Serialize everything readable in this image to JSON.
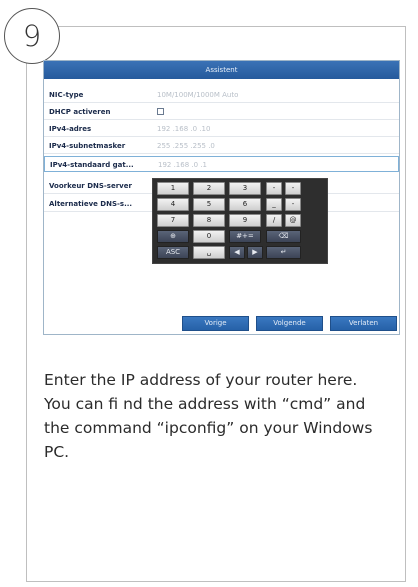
{
  "step_number": "9",
  "dialog": {
    "title": "Assistent",
    "fields": [
      {
        "label": "NIC-type",
        "value": "10M/100M/1000M Auto"
      },
      {
        "label": "DHCP activeren",
        "value": ""
      },
      {
        "label": "IPv4-adres",
        "value": "192 .168 .0    .10"
      },
      {
        "label": "IPv4-subnetmasker",
        "value": "255 .255 .255 .0"
      },
      {
        "label": "IPv4-standaard gat...",
        "value": "192 .168 .0    .1"
      },
      {
        "label": "Voorkeur DNS-server",
        "value": ""
      },
      {
        "label": "Alternatieve DNS-s...",
        "value": ""
      }
    ],
    "keypad": {
      "row1": [
        "1",
        "2",
        "3",
        "-",
        "-"
      ],
      "row2": [
        "4",
        "5",
        "6",
        "_",
        "-"
      ],
      "row3": [
        "7",
        "8",
        "9",
        "/",
        "@"
      ],
      "row4": [
        "⊕",
        "0",
        "#+=",
        "⌫"
      ],
      "row5": [
        "ASC",
        "␣",
        "◀",
        "▶",
        "↵"
      ]
    },
    "buttons": {
      "previous": "Vorige",
      "next": "Volgende",
      "exit": "Verlaten"
    }
  },
  "description": "Enter the IP address of your router here. You can fi nd the address with “cmd” and the command “ipconfig” on your Windows PC.",
  "colors": {
    "titlebar": "#2f68ad",
    "button": "#2f6cb4",
    "keypad_bg": "#2e2e2e"
  }
}
